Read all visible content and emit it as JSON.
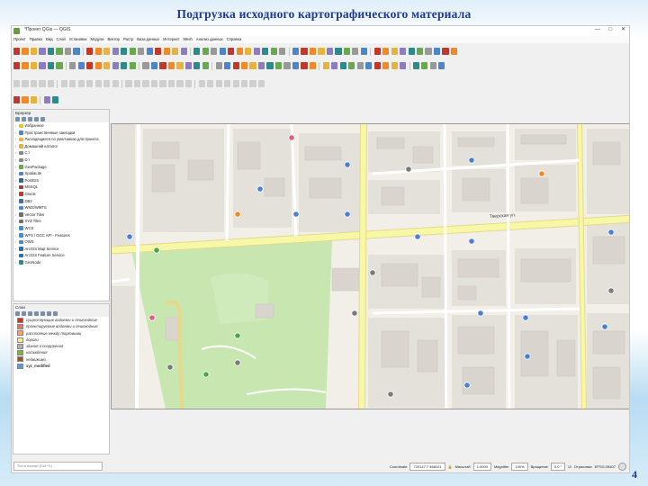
{
  "slide": {
    "title": "Подгрузка исходного картографического материала",
    "page_number": "4"
  },
  "window": {
    "title": "*Проект QGis — QGIS",
    "controls": [
      "—",
      "□",
      "✕"
    ]
  },
  "menu": [
    "Проект",
    "Правка",
    "Вид",
    "Слой",
    "Установки",
    "Модули",
    "Вектор",
    "Растр",
    "База данных",
    "Интернет",
    "Mesh",
    "Анализ данных",
    "Справка"
  ],
  "browser": {
    "title": "Браузер",
    "items": [
      {
        "label": "Избранное",
        "icon": "star-icon",
        "color": "#f2c21b"
      },
      {
        "label": "Пространственные закладки",
        "icon": "bookmark-icon",
        "color": "#4a86c8"
      },
      {
        "label": "Расходящиеся по умолчанию для проекта",
        "icon": "folder-icon",
        "color": "#e8b33a"
      },
      {
        "label": "Домашний каталог",
        "icon": "folder-icon",
        "color": "#e8b33a"
      },
      {
        "label": "C:\\",
        "icon": "drive-icon",
        "color": "#888888"
      },
      {
        "label": "D:\\",
        "icon": "drive-icon",
        "color": "#888888"
      },
      {
        "label": "GeoPackage",
        "icon": "geopackage-icon",
        "color": "#6aa84f"
      },
      {
        "label": "SpatiaLite",
        "icon": "spatialite-icon",
        "color": "#4a86c8"
      },
      {
        "label": "PostGIS",
        "icon": "postgis-icon",
        "color": "#336699"
      },
      {
        "label": "MSSQL",
        "icon": "mssql-icon",
        "color": "#a33d3d"
      },
      {
        "label": "Oracle",
        "icon": "oracle-icon",
        "color": "#c0392b"
      },
      {
        "label": "DB2",
        "icon": "db2-icon",
        "color": "#3d6fa3"
      },
      {
        "label": "WMS/WMTS",
        "icon": "globe-icon",
        "color": "#3b8fd9"
      },
      {
        "label": "Vector Tiles",
        "icon": "tiles-icon",
        "color": "#6f6f6f"
      },
      {
        "label": "XYZ Tiles",
        "icon": "tiles-icon",
        "color": "#6f6f6f"
      },
      {
        "label": "WCS",
        "icon": "globe-icon",
        "color": "#3b8fd9"
      },
      {
        "label": "WFS / OGC API - Features",
        "icon": "globe-icon",
        "color": "#3b8fd9"
      },
      {
        "label": "OWS",
        "icon": "globe-icon",
        "color": "#3b8fd9"
      },
      {
        "label": "ArcGIS Map Service",
        "icon": "arcgis-icon",
        "color": "#2d6db4"
      },
      {
        "label": "ArcGIS Feature Service",
        "icon": "arcgis-icon",
        "color": "#2d6db4"
      },
      {
        "label": "GeoNode",
        "icon": "geonode-icon",
        "color": "#2d8a8a"
      }
    ]
  },
  "layers": {
    "title": "Слои",
    "items": [
      {
        "label": "существующие водоемы и пешеходные",
        "color": "#c0392b"
      },
      {
        "label": "проектируемые водоемы и пешеходные",
        "color": "#e57373"
      },
      {
        "label": "расстояние между торговыми",
        "color": "#f4a460"
      },
      {
        "label": "дороги",
        "color": "#f5e79e"
      },
      {
        "label": "здания и сооружения",
        "color": "#b0b0b0"
      },
      {
        "label": "насаждения",
        "color": "#7cb342"
      },
      {
        "label": "недвижимо",
        "color": "#a0522d"
      },
      {
        "label": "xyz_modified",
        "color": "#5b9bd5"
      }
    ]
  },
  "search": {
    "placeholder": "Тип в поиске (Ctrl+K)"
  },
  "status": {
    "coordinate_label": "Coordinate",
    "coordinate": "720147.7 468101",
    "scale_label": "Масштаб",
    "scale": "1:3000",
    "magnifier_label": "Magnifier",
    "magnifier": "100%",
    "rotation_label": "Вращение",
    "rotation": "0,0 °",
    "render_label": "Отрисовка",
    "crs": "EPSG:28407"
  },
  "map": {
    "street_label": "Тверская ул."
  },
  "colors": {
    "title": "#1f3b8f",
    "road": "#f7f7a8",
    "road_edge": "#e8d88a",
    "park": "#c8e6b0",
    "building": "#d9d4cd",
    "block": "#e4e0da",
    "poi_blue": "#4a7fd4",
    "poi_orange": "#f08a24",
    "poi_pink": "#e05a8a",
    "poi_green": "#4ea64a"
  }
}
